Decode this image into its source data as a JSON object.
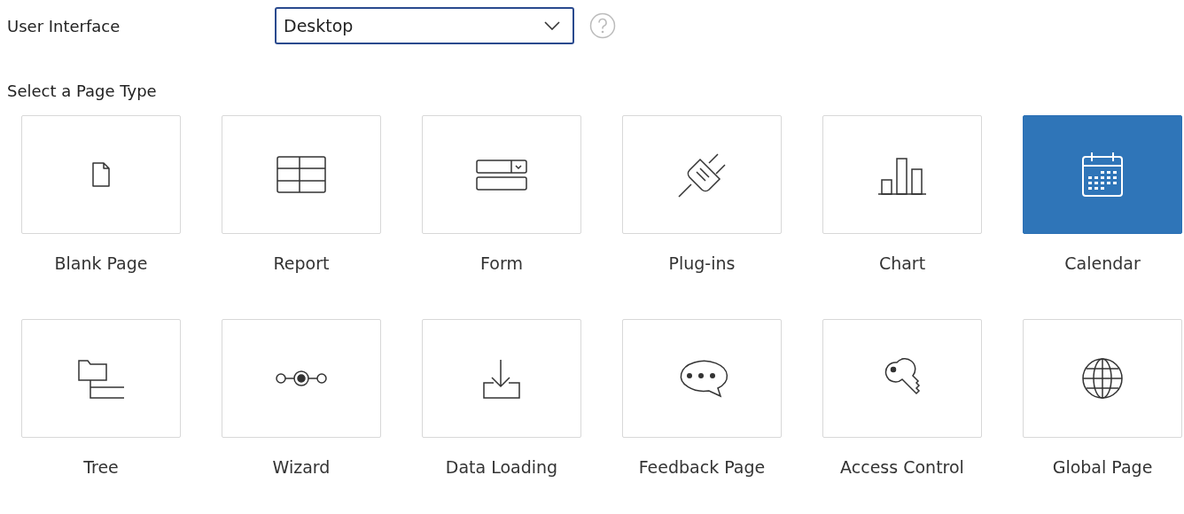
{
  "user_interface": {
    "label": "User Interface",
    "value": "Desktop"
  },
  "page_type": {
    "heading": "Select a Page Type",
    "options": [
      {
        "kind": "blank",
        "label": "Blank Page",
        "selected": false
      },
      {
        "kind": "report",
        "label": "Report",
        "selected": false
      },
      {
        "kind": "form",
        "label": "Form",
        "selected": false
      },
      {
        "kind": "plugin",
        "label": "Plug-ins",
        "selected": false
      },
      {
        "kind": "chart",
        "label": "Chart",
        "selected": false
      },
      {
        "kind": "calendar",
        "label": "Calendar",
        "selected": true
      },
      {
        "kind": "tree",
        "label": "Tree",
        "selected": false
      },
      {
        "kind": "wizard",
        "label": "Wizard",
        "selected": false
      },
      {
        "kind": "download",
        "label": "Data Loading",
        "selected": false
      },
      {
        "kind": "feedback",
        "label": "Feedback Page",
        "selected": false
      },
      {
        "kind": "key",
        "label": "Access Control",
        "selected": false
      },
      {
        "kind": "globe",
        "label": "Global Page",
        "selected": false
      }
    ]
  }
}
